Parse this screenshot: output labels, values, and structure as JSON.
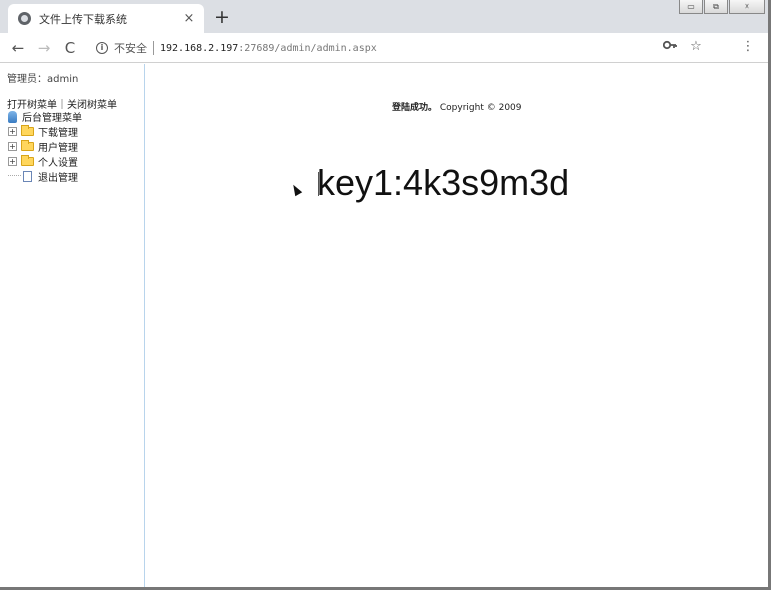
{
  "browser": {
    "tab_title": "文件上传下载系统",
    "tab_close": "×",
    "new_tab": "+",
    "nav": {
      "back": "←",
      "forward": "→",
      "reload": "C"
    },
    "security_label": "不安全",
    "url_host": "192.168.2.197",
    "url_rest": ":27689/admin/admin.aspx",
    "window_controls": [
      "▭",
      "⧉",
      "☓"
    ]
  },
  "sidebar": {
    "admin_label": "管理员：admin",
    "tree_actions": "打开树菜单｜关闭树菜单",
    "root_label": "后台管理菜单",
    "items": [
      {
        "label": "下载管理",
        "icon": "folder-icon",
        "expander": "+"
      },
      {
        "label": "用户管理",
        "icon": "folder-icon",
        "expander": "+"
      },
      {
        "label": "个人设置",
        "icon": "folder-icon",
        "expander": "+"
      },
      {
        "label": "退出管理",
        "icon": "document-icon"
      }
    ]
  },
  "main": {
    "login_success": "登陆成功。",
    "copyright": "Copyright © 2009",
    "key_text": "key1:4k3s9m3d"
  }
}
